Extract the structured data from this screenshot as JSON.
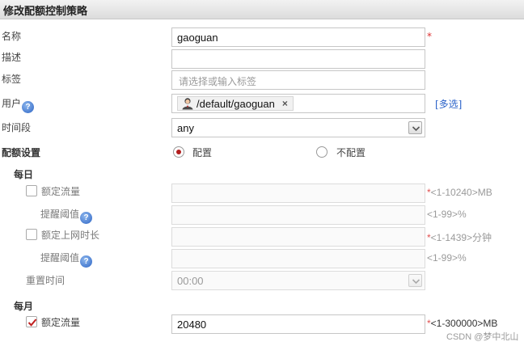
{
  "window": {
    "title": "修改配额控制策略"
  },
  "form": {
    "name": {
      "label": "名称",
      "value": "gaoguan",
      "required": "*"
    },
    "description": {
      "label": "描述",
      "value": ""
    },
    "tags": {
      "label": "标签",
      "placeholder": "请选择或输入标签"
    },
    "users": {
      "label": "用户",
      "help": "?",
      "chip_label": "/default/gaoguan",
      "remove": "×",
      "multi_select": "[多选]"
    },
    "time_period": {
      "label": "时间段",
      "value": "any"
    },
    "quota_setting": {
      "label": "配额设置",
      "option_on": "配置",
      "option_off": "不配置",
      "selected": "配置"
    },
    "daily": {
      "label": "每日",
      "traffic_quota": {
        "label": "额定流量",
        "checked": false,
        "value": "",
        "hint_star": "*",
        "hint": "<1-10240>MB"
      },
      "traffic_threshold": {
        "label": "提醒阈值",
        "help": "?",
        "value": "",
        "hint": "<1-99>%"
      },
      "online_time_quota": {
        "label": "额定上网时长",
        "checked": false,
        "value": "",
        "hint_star": "*",
        "hint": "<1-1439>分钟"
      },
      "time_threshold": {
        "label": "提醒阈值",
        "help": "?",
        "value": "",
        "hint": "<1-99>%"
      },
      "reset_time": {
        "label": "重置时间",
        "value": "00:00"
      }
    },
    "monthly": {
      "label": "每月",
      "traffic_quota": {
        "label": "额定流量",
        "checked": true,
        "value": "20480",
        "hint_star": "*",
        "hint": "<1-300000>MB"
      }
    }
  },
  "watermark": "CSDN @梦中北山",
  "colors": {
    "required": "#dd3333",
    "link": "#2a62c9",
    "radio_dot": "#b21e1e",
    "check": "#c02020"
  }
}
